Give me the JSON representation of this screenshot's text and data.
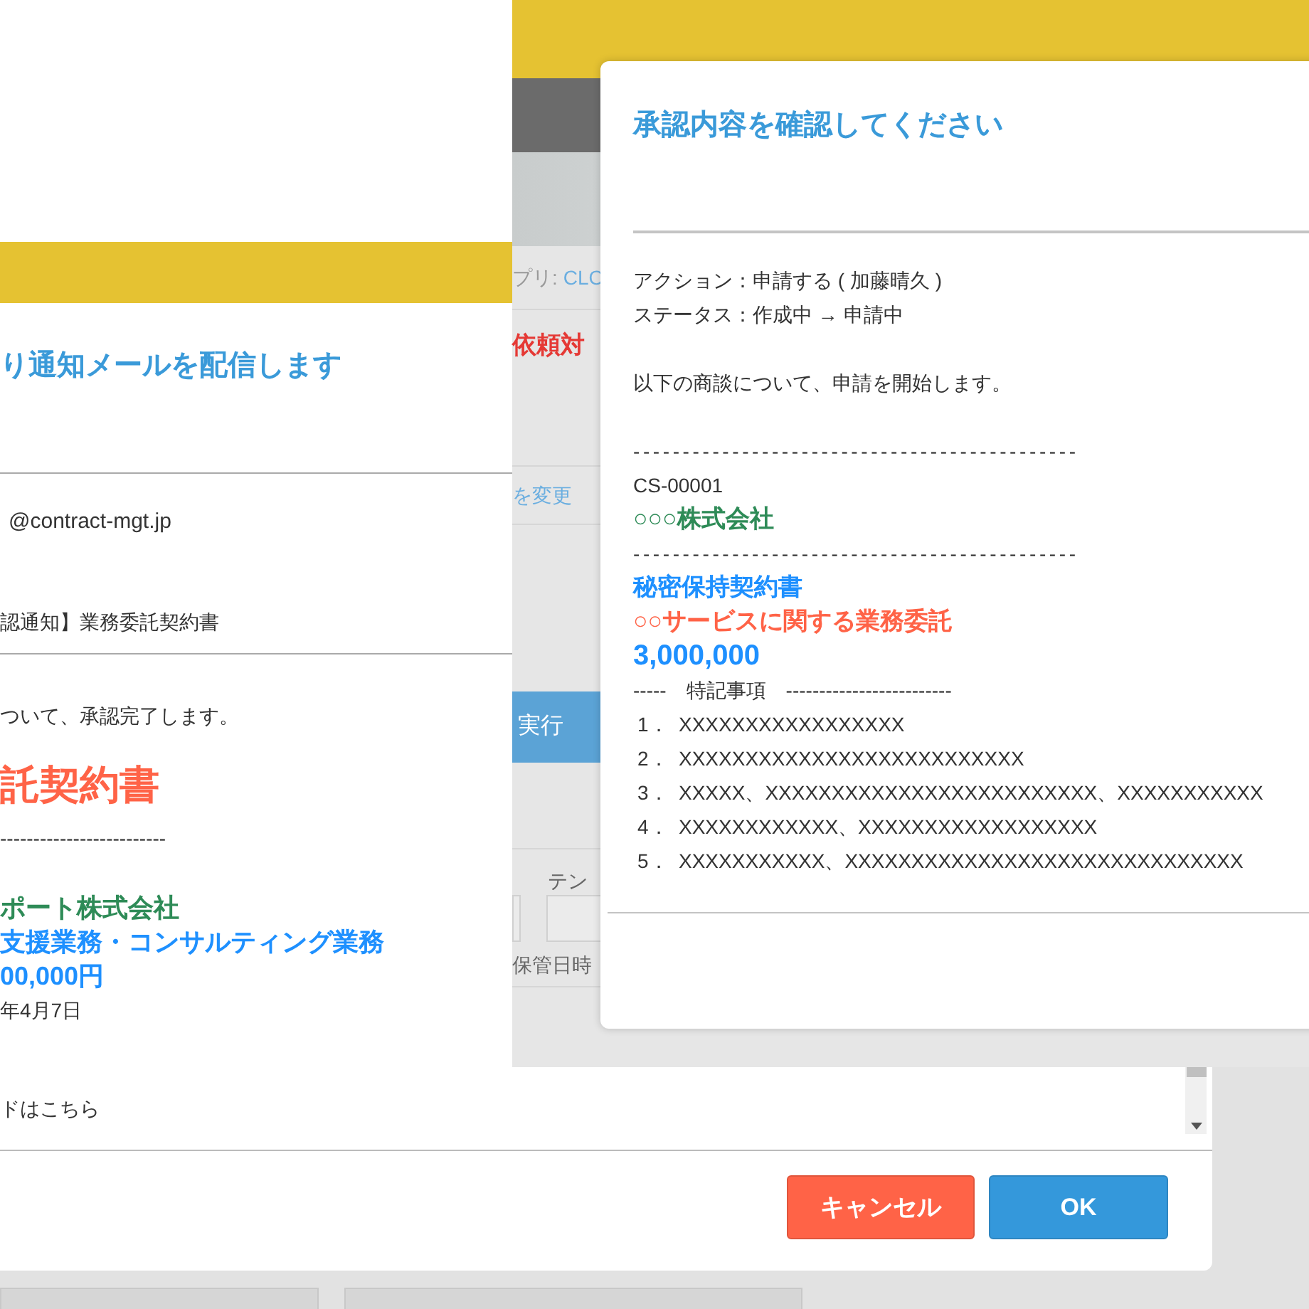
{
  "email_dialog": {
    "title": "り通知メールを配信します",
    "from": "@contract-mgt.jp",
    "subject": "認通知】業務委託契約書",
    "intro": "ついて、承認完了します。",
    "document_title": "託契約書",
    "separator": "-------------------------",
    "company": "ポート株式会社",
    "service": "支援業務・コンサルティング業務",
    "amount": "00,000円",
    "date": "年4月7日",
    "link_text": "ドはこちら"
  },
  "background_app": {
    "app_label": "プリ:",
    "app_link": "CLO",
    "heading": "依頼対",
    "change_link": "を変更",
    "run_button": "実行",
    "template_label": "テン",
    "storage_label": "保管日時"
  },
  "confirm_dialog": {
    "title": "承認内容を確認してください",
    "action": "アクション：申請する ( 加藤晴久 )",
    "status": "ステータス：作成中 → 申請中",
    "message": "以下の商談について、申請を開始します。",
    "separator": "---------------------------------------------",
    "case_id": "CS-00001",
    "company": "○○○株式会社",
    "separator_2": "---------------------------------------------",
    "document": "秘密保持契約書",
    "service": "○○サービスに関する業務委託",
    "amount": "3,000,000",
    "notes_heading": "-----　特記事項　-------------------------",
    "items": [
      {
        "number": "1．",
        "text": "XXXXXXXXXXXXXXXXX"
      },
      {
        "number": "2．",
        "text": "XXXXXXXXXXXXXXXXXXXXXXXXXX"
      },
      {
        "number": "3．",
        "text": "XXXXX、XXXXXXXXXXXXXXXXXXXXXXXXX、XXXXXXXXXXX"
      },
      {
        "number": "4．",
        "text": "XXXXXXXXXXXX、XXXXXXXXXXXXXXXXXX"
      },
      {
        "number": "5．",
        "text": "XXXXXXXXXXX、XXXXXXXXXXXXXXXXXXXXXXXXXXXXXX"
      }
    ]
  },
  "buttons": [
    {
      "label": "キャンセル",
      "kind": "cancel"
    },
    {
      "label": "OK",
      "kind": "ok"
    }
  ]
}
